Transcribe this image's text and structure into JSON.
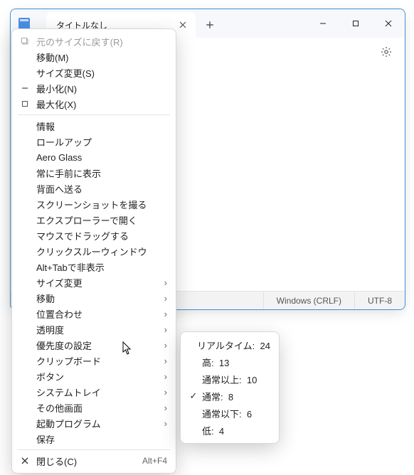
{
  "window": {
    "tab_title": "タイトルなし",
    "statusbar": {
      "line_ending": "Windows (CRLF)",
      "encoding": "UTF-8"
    }
  },
  "menu": {
    "restore": {
      "label": "元のサイズに戻す(R)"
    },
    "move": {
      "label": "移動(M)"
    },
    "size": {
      "label": "サイズ変更(S)"
    },
    "minimize": {
      "label": "最小化(N)"
    },
    "maximize": {
      "label": "最大化(X)"
    },
    "info": {
      "label": "情報"
    },
    "rollup": {
      "label": "ロールアップ"
    },
    "aero": {
      "label": "Aero Glass"
    },
    "topmost": {
      "label": "常に手前に表示"
    },
    "sendback": {
      "label": "背面へ送る"
    },
    "screenshot": {
      "label": "スクリーンショットを撮る"
    },
    "explorer": {
      "label": "エクスプローラーで開く"
    },
    "mousedrag": {
      "label": "マウスでドラッグする"
    },
    "clickthru": {
      "label": "クリックスルーウィンドウ"
    },
    "alttabhide": {
      "label": "Alt+Tabで非表示"
    },
    "resize_sub": {
      "label": "サイズ変更"
    },
    "move_sub": {
      "label": "移動"
    },
    "align": {
      "label": "位置合わせ"
    },
    "opacity": {
      "label": "透明度"
    },
    "priority": {
      "label": "優先度の設定"
    },
    "clipboard": {
      "label": "クリップボード"
    },
    "button": {
      "label": "ボタン"
    },
    "tray": {
      "label": "システムトレイ"
    },
    "otherscr": {
      "label": "その他画面"
    },
    "startup": {
      "label": "起動プログラム"
    },
    "save": {
      "label": "保存"
    },
    "close": {
      "label": "閉じる(C)",
      "accel": "Alt+F4"
    }
  },
  "submenu_priority": {
    "realtime": {
      "label": "リアルタイム:",
      "value": "24"
    },
    "high": {
      "label": "高:",
      "value": "13"
    },
    "above": {
      "label": "通常以上:",
      "value": "10"
    },
    "normal": {
      "label": "通常:",
      "value": "8"
    },
    "below": {
      "label": "通常以下:",
      "value": "6"
    },
    "low": {
      "label": "低:",
      "value": "4"
    }
  }
}
